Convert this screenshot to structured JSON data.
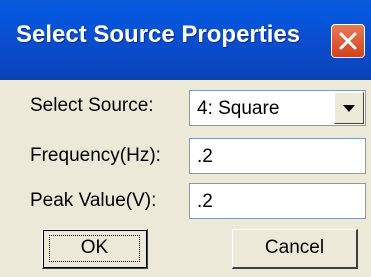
{
  "dialog": {
    "title": "Select Source Properties",
    "close_icon": "close-icon"
  },
  "fields": {
    "source_label": "Select Source:",
    "source_value": "4: Square",
    "frequency_label": "Frequency(Hz):",
    "frequency_value": ".2",
    "peak_label": "Peak Value(V):",
    "peak_value": ".2"
  },
  "buttons": {
    "ok_label": "OK",
    "cancel_label": "Cancel"
  },
  "colors": {
    "titlebar": "#0a4fd0",
    "close": "#d2401c",
    "face": "#ece9d8"
  }
}
